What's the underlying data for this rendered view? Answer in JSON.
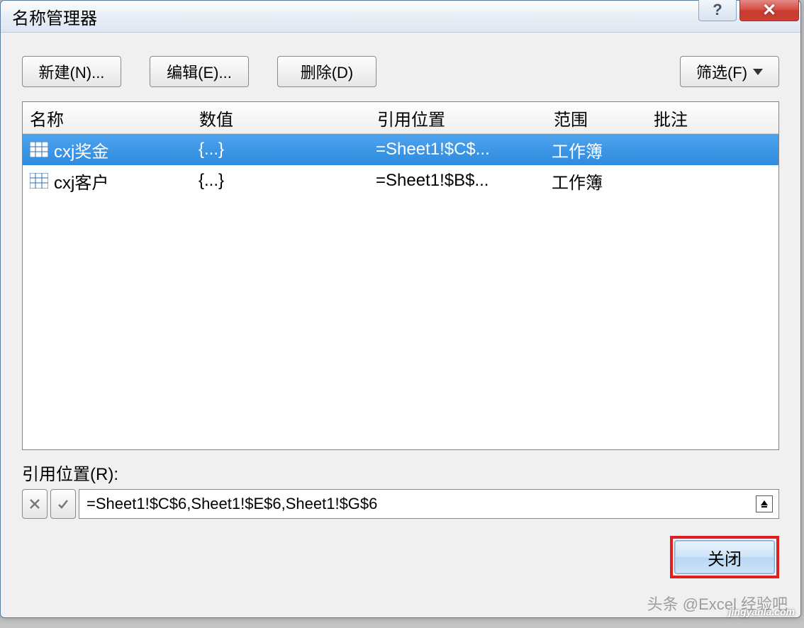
{
  "window": {
    "title": "名称管理器"
  },
  "toolbar": {
    "new_label": "新建(N)...",
    "edit_label": "编辑(E)...",
    "delete_label": "删除(D)",
    "filter_label": "筛选(F)"
  },
  "headers": {
    "name": "名称",
    "value": "数值",
    "ref": "引用位置",
    "scope": "范围",
    "comment": "批注"
  },
  "rows": [
    {
      "selected": true,
      "name": "cxj奖金",
      "value": "{...}",
      "ref": "=Sheet1!$C$...",
      "scope": "工作簿",
      "comment": ""
    },
    {
      "selected": false,
      "name": "cxj客户",
      "value": "{...}",
      "ref": "=Sheet1!$B$...",
      "scope": "工作簿",
      "comment": ""
    }
  ],
  "ref_section": {
    "label": "引用位置(R):",
    "value": "=Sheet1!$C$6,Sheet1!$E$6,Sheet1!$G$6"
  },
  "buttons": {
    "close": "关闭"
  },
  "watermark": "头条 @Excel 经验吧",
  "watermark2": "jingyanla.com"
}
